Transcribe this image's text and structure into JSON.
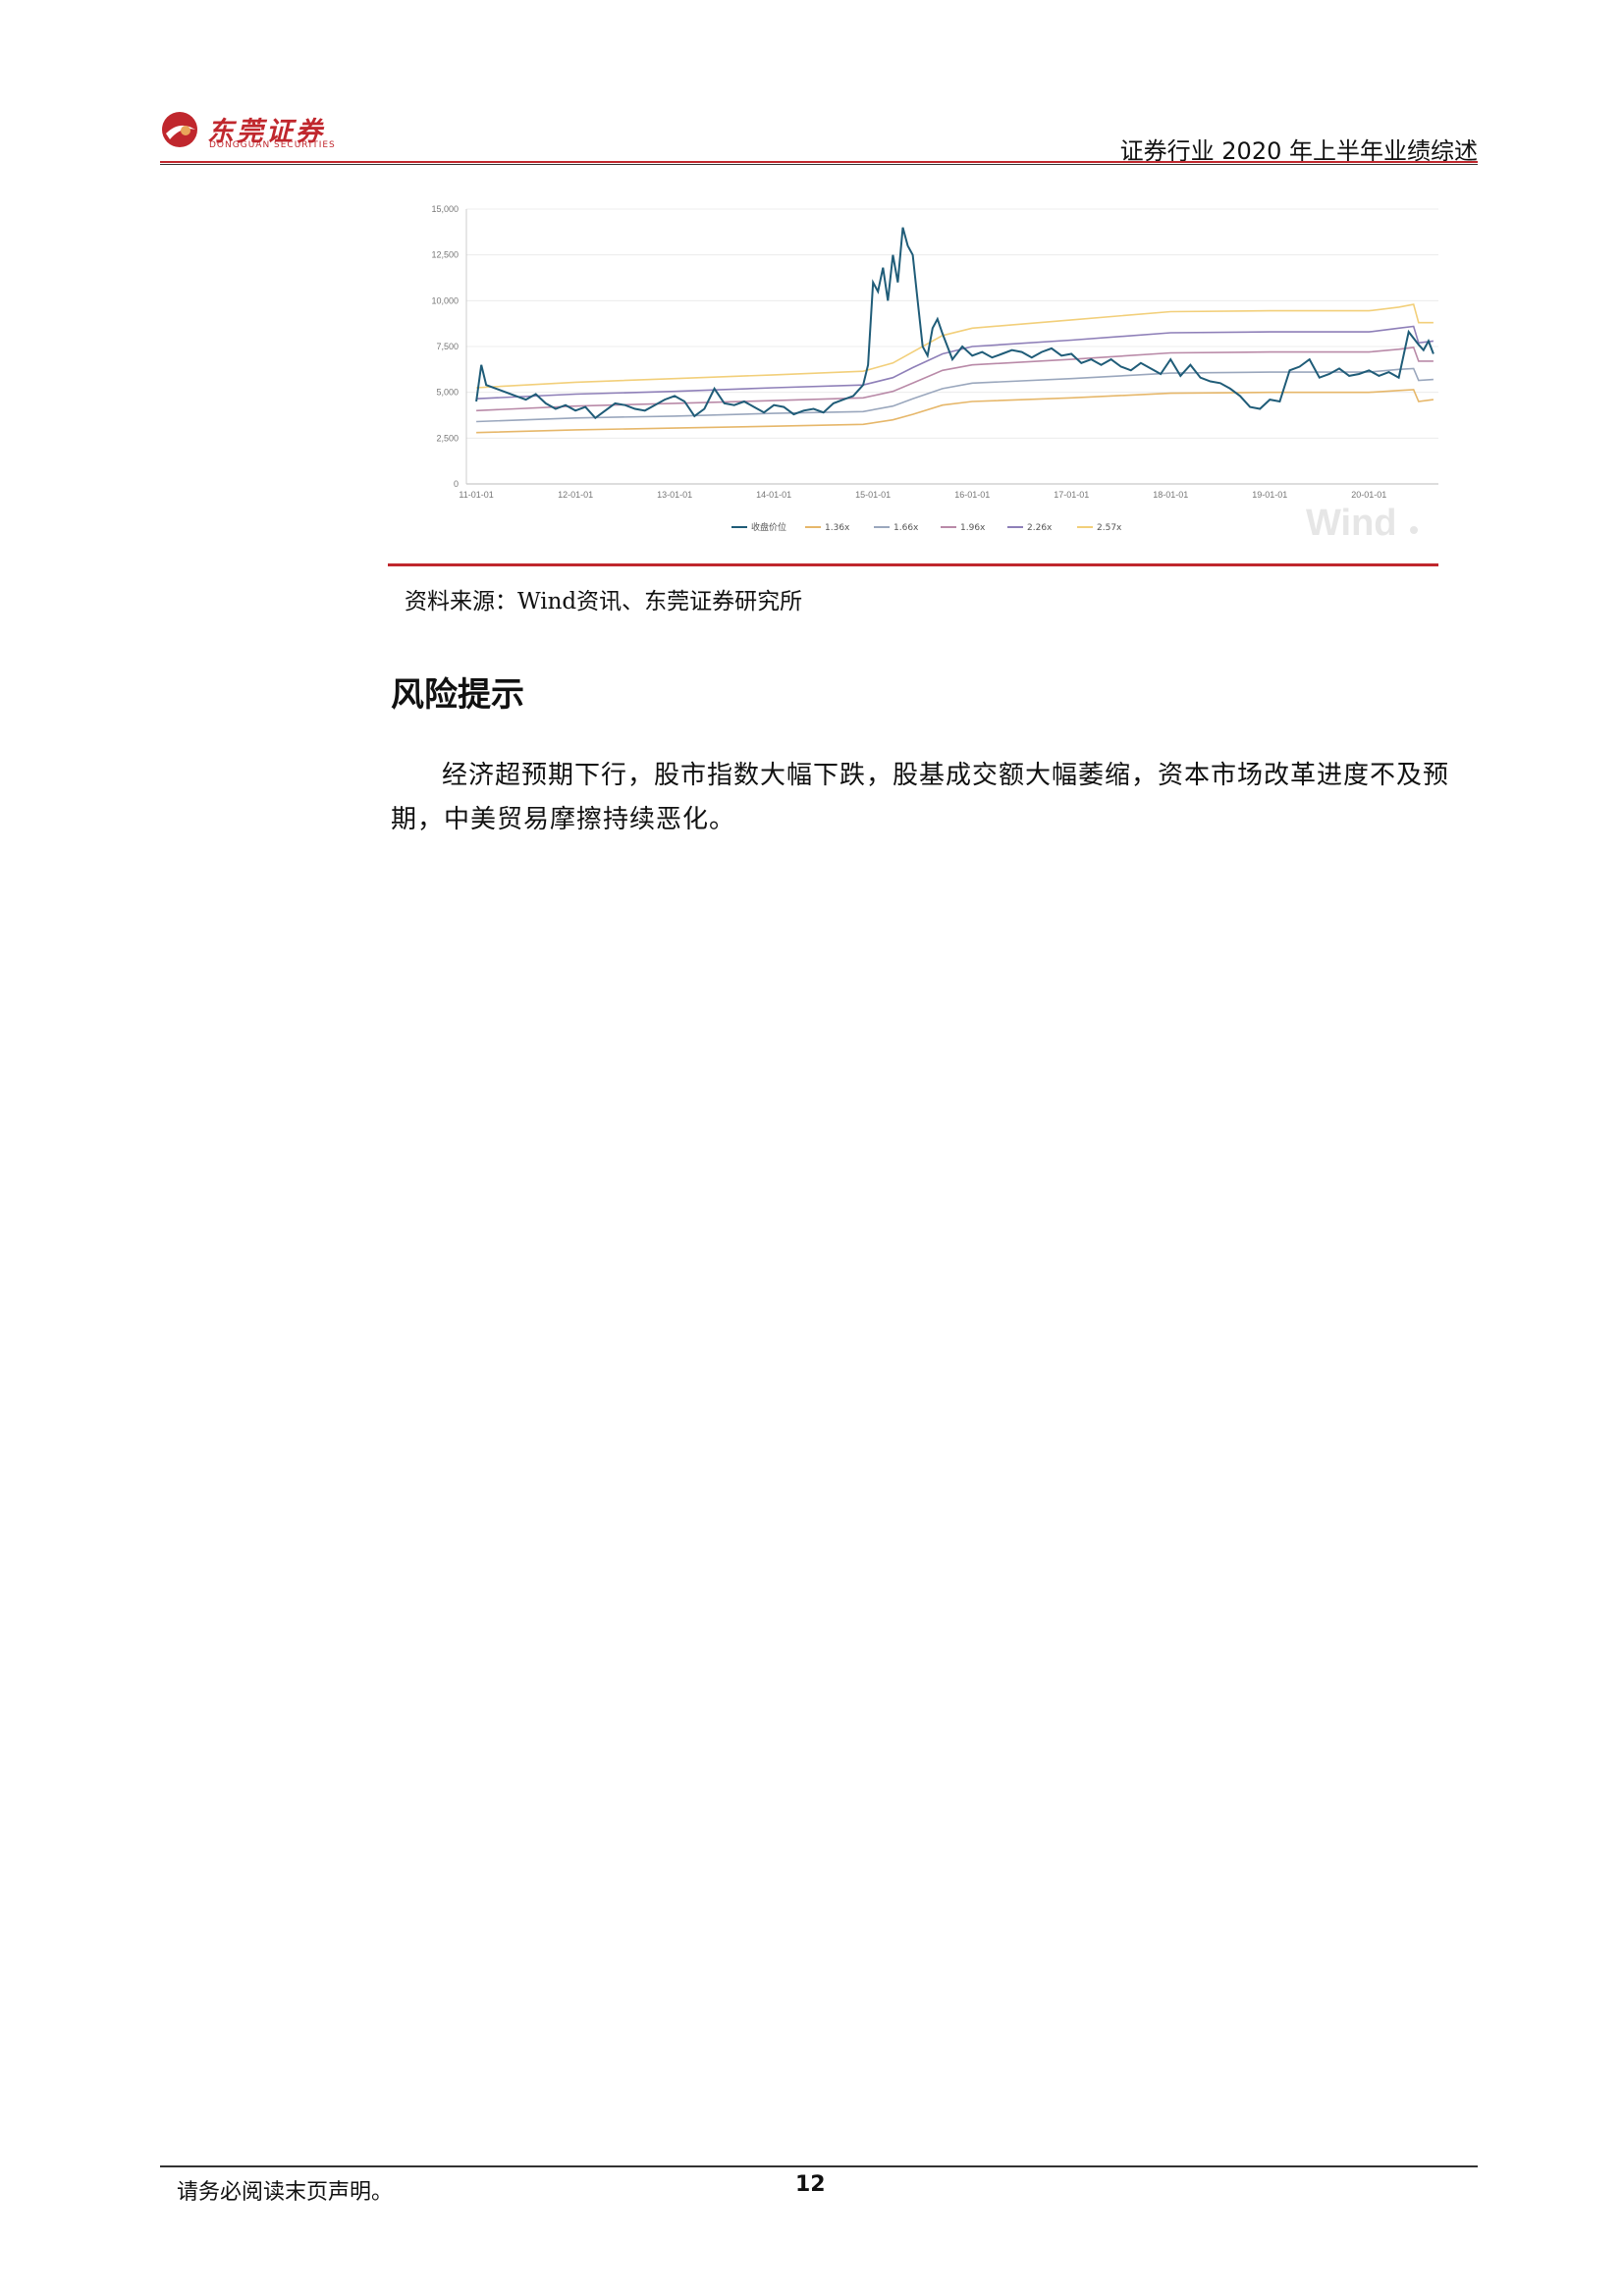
{
  "header": {
    "logo_text": "东莞证券",
    "logo_sub": "DONGGUAN SECURITIES",
    "title": "证券行业 2020 年上半年业绩综述"
  },
  "figure": {
    "source": "资料来源：Wind资讯、东莞证券研究所",
    "watermark": "Wind"
  },
  "section": {
    "title": "风险提示",
    "paragraph": "经济超预期下行，股市指数大幅下跌，股基成交额大幅萎缩，资本市场改革进度不及预期，中美贸易摩擦持续恶化。"
  },
  "footer": {
    "note": "请务必阅读末页声明。",
    "page": "12"
  },
  "chart_data": {
    "type": "line",
    "title": "",
    "xlabel": "",
    "ylabel": "",
    "ylim": [
      0,
      15000
    ],
    "yticks": [
      "0",
      "2,500",
      "5,000",
      "7,500",
      "10,000",
      "12,500",
      "15,000"
    ],
    "ytick_values": [
      0,
      2500,
      5000,
      7500,
      10000,
      12500,
      15000
    ],
    "xticks": [
      "11-01-01",
      "12-01-01",
      "13-01-01",
      "14-01-01",
      "15-01-01",
      "16-01-01",
      "17-01-01",
      "18-01-01",
      "19-01-01",
      "20-01-01"
    ],
    "x_range": [
      2010.9,
      2020.7
    ],
    "grid": true,
    "legend_position": "bottom",
    "colors": {
      "price": "#1f5c78",
      "1.36x": "#e6b76a",
      "1.66x": "#9aa7bd",
      "1.96x": "#b98aa8",
      "2.26x": "#8e7fb8",
      "2.57x": "#f2cf7a"
    },
    "series": [
      {
        "name": "收盘价位",
        "x": [
          2011.0,
          2011.05,
          2011.1,
          2011.2,
          2011.3,
          2011.4,
          2011.5,
          2011.6,
          2011.7,
          2011.8,
          2011.9,
          2012.0,
          2012.1,
          2012.2,
          2012.3,
          2012.4,
          2012.5,
          2012.6,
          2012.7,
          2012.8,
          2012.9,
          2013.0,
          2013.1,
          2013.2,
          2013.3,
          2013.4,
          2013.5,
          2013.6,
          2013.7,
          2013.8,
          2013.9,
          2014.0,
          2014.1,
          2014.2,
          2014.3,
          2014.4,
          2014.5,
          2014.6,
          2014.7,
          2014.8,
          2014.85,
          2014.9,
          2014.95,
          2015.0,
          2015.05,
          2015.1,
          2015.15,
          2015.2,
          2015.25,
          2015.3,
          2015.35,
          2015.4,
          2015.45,
          2015.5,
          2015.55,
          2015.6,
          2015.65,
          2015.7,
          2015.8,
          2015.9,
          2016.0,
          2016.1,
          2016.2,
          2016.3,
          2016.4,
          2016.5,
          2016.6,
          2016.7,
          2016.8,
          2016.9,
          2017.0,
          2017.1,
          2017.2,
          2017.3,
          2017.4,
          2017.5,
          2017.6,
          2017.7,
          2017.8,
          2017.9,
          2018.0,
          2018.1,
          2018.2,
          2018.3,
          2018.4,
          2018.5,
          2018.6,
          2018.7,
          2018.8,
          2018.9,
          2019.0,
          2019.1,
          2019.2,
          2019.3,
          2019.4,
          2019.5,
          2019.6,
          2019.7,
          2019.8,
          2019.9,
          2020.0,
          2020.1,
          2020.2,
          2020.3,
          2020.4,
          2020.5,
          2020.55,
          2020.6,
          2020.65
        ],
        "y": [
          4500,
          6500,
          5400,
          5200,
          5000,
          4800,
          4600,
          4900,
          4400,
          4100,
          4300,
          4000,
          4200,
          3600,
          4000,
          4400,
          4300,
          4100,
          4000,
          4300,
          4600,
          4800,
          4500,
          3700,
          4100,
          5200,
          4400,
          4300,
          4500,
          4200,
          3900,
          4300,
          4200,
          3800,
          4000,
          4100,
          3900,
          4400,
          4600,
          4800,
          5100,
          5400,
          6500,
          11000,
          10500,
          11800,
          10000,
          12500,
          11000,
          14000,
          13000,
          12500,
          10000,
          7500,
          7000,
          8500,
          9000,
          8200,
          6800,
          7500,
          7000,
          7200,
          6900,
          7100,
          7300,
          7200,
          6900,
          7200,
          7400,
          7000,
          7100,
          6600,
          6800,
          6500,
          6800,
          6400,
          6200,
          6600,
          6300,
          6000,
          6800,
          5900,
          6500,
          5800,
          5600,
          5500,
          5200,
          4800,
          4200,
          4100,
          4600,
          4500,
          6200,
          6400,
          6800,
          5800,
          6000,
          6300,
          5900,
          6000,
          6200,
          5900,
          6100,
          5800,
          8300,
          7600,
          7300,
          7800,
          7100
        ]
      },
      {
        "name": "1.36x",
        "x": [
          2011.0,
          2012.0,
          2013.0,
          2014.0,
          2014.9,
          2015.2,
          2015.4,
          2015.7,
          2016.0,
          2017.0,
          2018.0,
          2019.0,
          2020.0,
          2020.3,
          2020.45,
          2020.5,
          2020.65
        ],
        "y": [
          2800,
          2950,
          3050,
          3150,
          3250,
          3500,
          3800,
          4300,
          4500,
          4700,
          4950,
          5000,
          5000,
          5100,
          5150,
          4500,
          4600
        ]
      },
      {
        "name": "1.66x",
        "x": [
          2011.0,
          2012.0,
          2013.0,
          2014.0,
          2014.9,
          2015.2,
          2015.4,
          2015.7,
          2016.0,
          2017.0,
          2018.0,
          2019.0,
          2020.0,
          2020.3,
          2020.45,
          2020.5,
          2020.65
        ],
        "y": [
          3400,
          3600,
          3700,
          3850,
          3950,
          4250,
          4650,
          5200,
          5500,
          5750,
          6050,
          6100,
          6100,
          6250,
          6300,
          5650,
          5700
        ]
      },
      {
        "name": "1.96x",
        "x": [
          2011.0,
          2012.0,
          2013.0,
          2014.0,
          2014.9,
          2015.2,
          2015.4,
          2015.7,
          2016.0,
          2017.0,
          2018.0,
          2019.0,
          2020.0,
          2020.3,
          2020.45,
          2020.5,
          2020.65
        ],
        "y": [
          4000,
          4250,
          4400,
          4550,
          4700,
          5050,
          5500,
          6200,
          6500,
          6800,
          7150,
          7200,
          7200,
          7350,
          7450,
          6700,
          6700
        ]
      },
      {
        "name": "2.26x",
        "x": [
          2011.0,
          2012.0,
          2013.0,
          2014.0,
          2014.9,
          2015.2,
          2015.4,
          2015.7,
          2016.0,
          2017.0,
          2018.0,
          2019.0,
          2020.0,
          2020.3,
          2020.45,
          2020.5,
          2020.65
        ],
        "y": [
          4650,
          4900,
          5050,
          5250,
          5400,
          5800,
          6350,
          7100,
          7500,
          7850,
          8250,
          8300,
          8300,
          8500,
          8600,
          7700,
          7800
        ]
      },
      {
        "name": "2.57x",
        "x": [
          2011.0,
          2012.0,
          2013.0,
          2014.0,
          2014.9,
          2015.2,
          2015.4,
          2015.7,
          2016.0,
          2017.0,
          2018.0,
          2019.0,
          2020.0,
          2020.3,
          2020.45,
          2020.5,
          2020.65
        ],
        "y": [
          5250,
          5550,
          5750,
          5950,
          6150,
          6600,
          7200,
          8100,
          8500,
          8950,
          9400,
          9450,
          9450,
          9650,
          9800,
          8800,
          8800
        ]
      }
    ]
  }
}
